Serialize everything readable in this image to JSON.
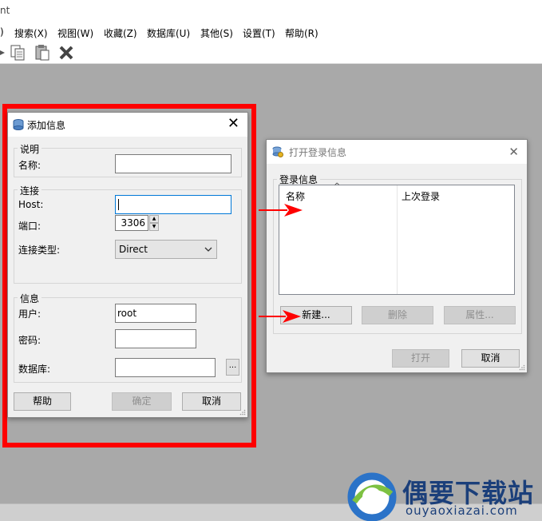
{
  "app": {
    "title_fragment": "nt",
    "menu": [
      "搜索(X)",
      "视图(W)",
      "收藏(Z)",
      "数据库(U)",
      "其他(S)",
      "设置(T)",
      "帮助(R)"
    ],
    "menu_partial_left": ")"
  },
  "add_dialog": {
    "title": "添加信息",
    "section_desc": "说明",
    "name_label": "名称:",
    "name_value": "",
    "section_conn": "连接",
    "host_label": "Host:",
    "host_value": "",
    "port_label": "端口:",
    "port_value": "3306",
    "conn_type_label": "连接类型:",
    "conn_type_value": "Direct",
    "section_info": "信息",
    "user_label": "用户:",
    "user_value": "root",
    "password_label": "密码:",
    "password_value": "",
    "db_label": "数据库:",
    "db_value": "",
    "browse_label": "...",
    "help_button": "帮助",
    "ok_button": "确定",
    "cancel_button": "取消"
  },
  "open_dialog": {
    "title": "打开登录信息",
    "section_login": "登录信息",
    "columns": [
      "名称",
      "上次登录"
    ],
    "new_button": "新建...",
    "delete_button": "删除",
    "props_button": "属性...",
    "open_button": "打开",
    "cancel_button": "取消"
  },
  "watermark": {
    "brand": "偶要下载站",
    "url": "ouyaoxiazai.com"
  },
  "colors": {
    "highlight_frame": "#ff0000",
    "arrow": "#ff0000",
    "workspace": "#a9a9a9",
    "dialog_bg": "#f0f0f0",
    "brand_blue": "#1b3f7a"
  }
}
